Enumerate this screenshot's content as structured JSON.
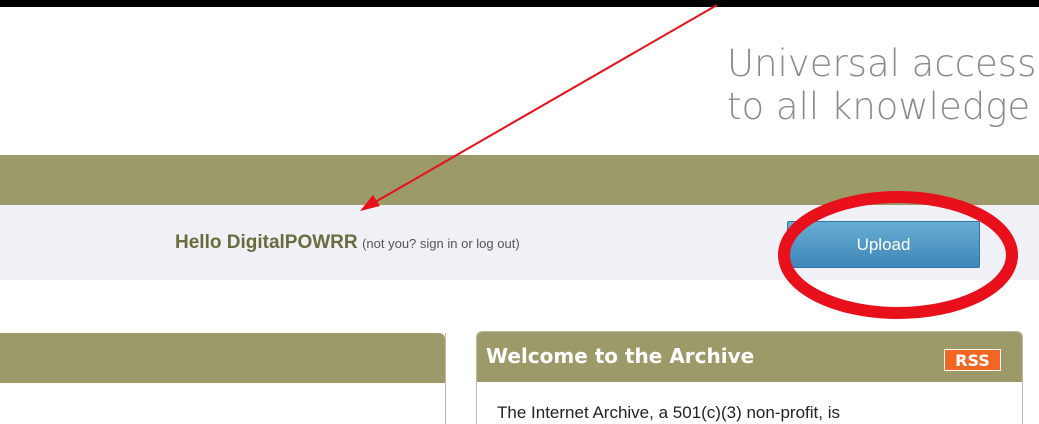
{
  "header": {
    "tagline_line1": "Universal access",
    "tagline_line2": "to all knowledge"
  },
  "greeting": {
    "hello": "Hello DigitalPOWRR",
    "prefix": "(not you? ",
    "sign_in": "sign in",
    "or": " or ",
    "log_out": "log out",
    "suffix": ")"
  },
  "upload": {
    "label": "Upload"
  },
  "welcome_panel": {
    "title": "Welcome to the Archive",
    "rss": "RSS",
    "body": "The Internet Archive, a 501(c)(3) non-profit, is"
  },
  "colors": {
    "olive": "#9c9a69",
    "greet_bg": "#f0f0f7",
    "upload_blue": "#4b96c6",
    "rss_orange": "#f26522",
    "annotation_red": "#e8101a"
  }
}
